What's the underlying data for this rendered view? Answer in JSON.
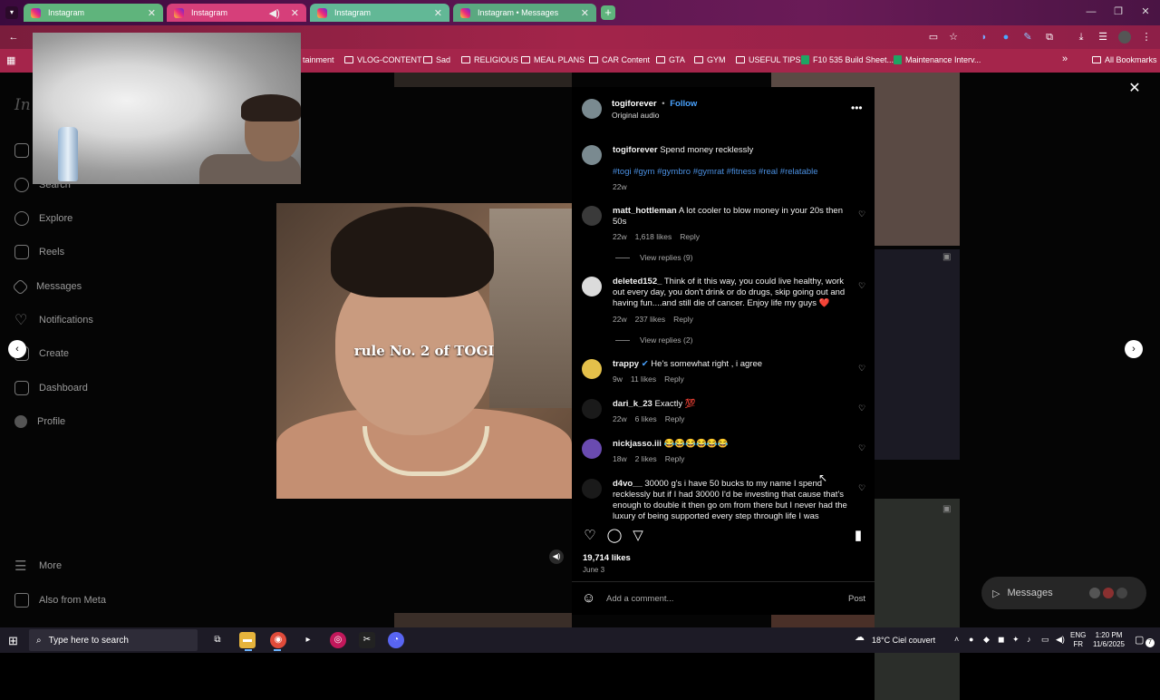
{
  "browser": {
    "tabs": [
      {
        "label": "Instagram",
        "style": "g"
      },
      {
        "label": "Instagram",
        "style": "active"
      },
      {
        "label": "Instagram",
        "style": "g2"
      },
      {
        "label": "Instagram • Messages",
        "style": "g3"
      }
    ],
    "new_tab_glyph": "+",
    "bookmarks": [
      {
        "label": "tainment",
        "kind": "folder"
      },
      {
        "label": "VLOG-CONTENT",
        "kind": "folder"
      },
      {
        "label": "Sad",
        "kind": "folder"
      },
      {
        "label": "RELIGIOUS",
        "kind": "folder"
      },
      {
        "label": "MEAL PLANS",
        "kind": "folder"
      },
      {
        "label": "CAR Content",
        "kind": "folder"
      },
      {
        "label": "GTA",
        "kind": "folder"
      },
      {
        "label": "GYM",
        "kind": "folder"
      },
      {
        "label": "USEFUL TIPS",
        "kind": "folder"
      },
      {
        "label": "F10 535 Build Sheet...",
        "kind": "sheet"
      },
      {
        "label": "Maintenance Interv...",
        "kind": "sheet"
      }
    ],
    "more_bookmarks": "»",
    "all_bookmarks": "All Bookmarks"
  },
  "sidebar": {
    "search_label": "Search",
    "items": [
      "Explore",
      "Reels",
      "Messages",
      "Notifications",
      "Create",
      "Dashboard",
      "Profile"
    ],
    "more": "More",
    "also_from_meta": "Also from Meta"
  },
  "video": {
    "caption": "rule No. 2 of TOGI"
  },
  "post": {
    "username": "togiforever",
    "follow": "Follow",
    "separator": "•",
    "audio": "Original audio",
    "caption_user": "togiforever",
    "caption_text": "Spend money recklessly",
    "hashtags": "#togi #gym #gymbro #gymrat #fitness #real #relatable",
    "caption_age": "22w",
    "comments": [
      {
        "user": "matt_hottleman",
        "text": "A lot cooler to blow money in your 20s then 50s",
        "age": "22w",
        "likes": "1,618 likes",
        "reply": "Reply",
        "view_replies": "View replies (9)",
        "avatar_color": "#3a3a3a"
      },
      {
        "user": "deleted152_",
        "text": "Think of it this way, you could live healthy, work out every day, you don't drink or do drugs, skip going out and having fun....and still die of cancer. Enjoy life my guys ❤️",
        "age": "22w",
        "likes": "237 likes",
        "reply": "Reply",
        "view_replies": "View replies (2)",
        "avatar_color": "#dbdbdb"
      },
      {
        "user": "trappy",
        "text": "He's somewhat right , i agree",
        "age": "9w",
        "likes": "11 likes",
        "reply": "Reply",
        "avatar_color": "#e4c04a"
      },
      {
        "user": "dari_k_23",
        "text": "Exactly 💯",
        "age": "22w",
        "likes": "6 likes",
        "reply": "Reply",
        "avatar_color": "#1a1a1a"
      },
      {
        "user": "nickjasso.iii",
        "text": "😂😂😂😂😂😂",
        "age": "18w",
        "likes": "2 likes",
        "reply": "Reply",
        "avatar_color": "#6a4bb0"
      },
      {
        "user": "d4vo__",
        "text": "30000 g's i have 50 bucks to my name I spend recklessly but if I had 30000 I'd be investing that cause that's enough to double it then go om from there but I never had the luxury of being supported every step through life I was",
        "avatar_color": "#1a1a1a"
      }
    ],
    "likes": "19,714 likes",
    "date": "June 3",
    "comment_placeholder": "Add a comment...",
    "post_button": "Post"
  },
  "messages_pill": "Messages",
  "taskbar": {
    "search_placeholder": "Type here to search",
    "weather": "18°C  Ciel couvert",
    "lang_top": "ENG",
    "lang_bottom": "FR",
    "time": "1:20 PM",
    "date": "11/6/2025",
    "notifications_count": "7"
  }
}
